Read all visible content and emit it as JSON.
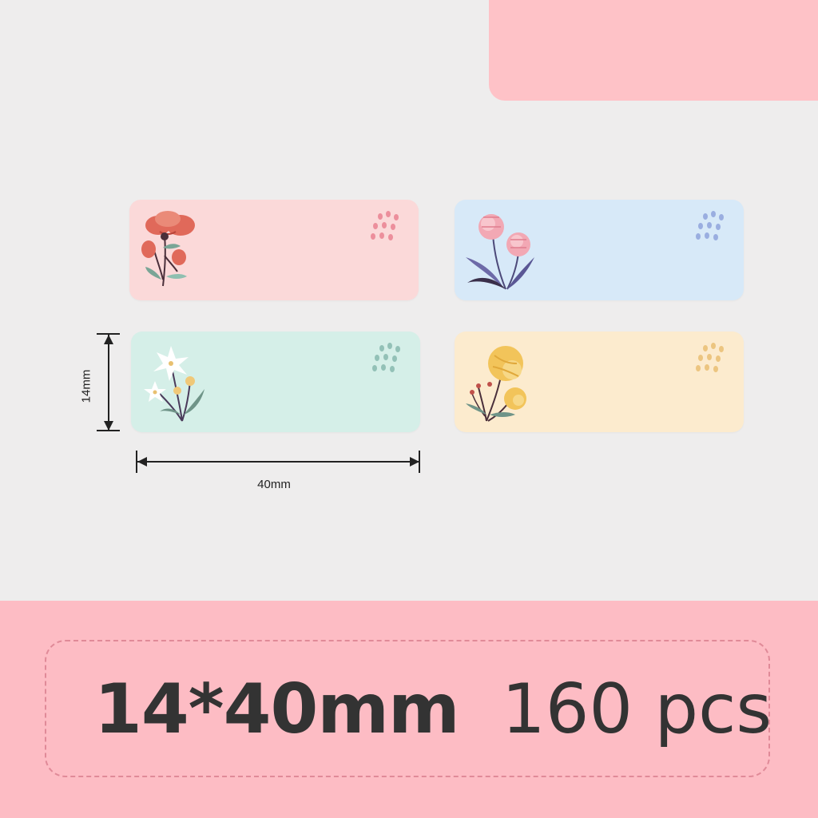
{
  "dimensions": {
    "height_label": "14mm",
    "width_label": "40mm"
  },
  "spec": {
    "size_text": "14*40mm",
    "count_text": "160 pcs"
  },
  "labels": [
    {
      "name": "pink",
      "bg": "#fbd9d9",
      "flower_icon": "red-poppy-icon"
    },
    {
      "name": "blue",
      "bg": "#d7e9f8",
      "flower_icon": "pink-carnation-icon"
    },
    {
      "name": "mint",
      "bg": "#d5efe8",
      "flower_icon": "white-lily-icon"
    },
    {
      "name": "yellow",
      "bg": "#fcebce",
      "flower_icon": "yellow-flower-icon"
    }
  ],
  "colors": {
    "page_bg": "#eeeded",
    "accent_pink": "#fdbcc4",
    "dashed_border": "#e08a98",
    "text_dark": "#333333"
  }
}
